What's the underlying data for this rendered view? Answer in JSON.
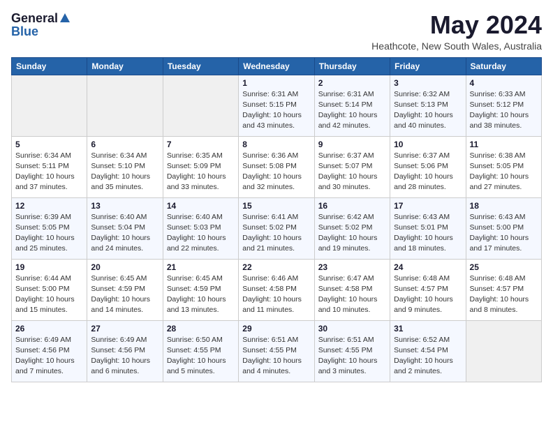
{
  "header": {
    "logo_general": "General",
    "logo_blue": "Blue",
    "title": "May 2024",
    "location": "Heathcote, New South Wales, Australia"
  },
  "days_of_week": [
    "Sunday",
    "Monday",
    "Tuesday",
    "Wednesday",
    "Thursday",
    "Friday",
    "Saturday"
  ],
  "weeks": [
    [
      {
        "num": "",
        "detail": ""
      },
      {
        "num": "",
        "detail": ""
      },
      {
        "num": "",
        "detail": ""
      },
      {
        "num": "1",
        "detail": "Sunrise: 6:31 AM\nSunset: 5:15 PM\nDaylight: 10 hours\nand 43 minutes."
      },
      {
        "num": "2",
        "detail": "Sunrise: 6:31 AM\nSunset: 5:14 PM\nDaylight: 10 hours\nand 42 minutes."
      },
      {
        "num": "3",
        "detail": "Sunrise: 6:32 AM\nSunset: 5:13 PM\nDaylight: 10 hours\nand 40 minutes."
      },
      {
        "num": "4",
        "detail": "Sunrise: 6:33 AM\nSunset: 5:12 PM\nDaylight: 10 hours\nand 38 minutes."
      }
    ],
    [
      {
        "num": "5",
        "detail": "Sunrise: 6:34 AM\nSunset: 5:11 PM\nDaylight: 10 hours\nand 37 minutes."
      },
      {
        "num": "6",
        "detail": "Sunrise: 6:34 AM\nSunset: 5:10 PM\nDaylight: 10 hours\nand 35 minutes."
      },
      {
        "num": "7",
        "detail": "Sunrise: 6:35 AM\nSunset: 5:09 PM\nDaylight: 10 hours\nand 33 minutes."
      },
      {
        "num": "8",
        "detail": "Sunrise: 6:36 AM\nSunset: 5:08 PM\nDaylight: 10 hours\nand 32 minutes."
      },
      {
        "num": "9",
        "detail": "Sunrise: 6:37 AM\nSunset: 5:07 PM\nDaylight: 10 hours\nand 30 minutes."
      },
      {
        "num": "10",
        "detail": "Sunrise: 6:37 AM\nSunset: 5:06 PM\nDaylight: 10 hours\nand 28 minutes."
      },
      {
        "num": "11",
        "detail": "Sunrise: 6:38 AM\nSunset: 5:05 PM\nDaylight: 10 hours\nand 27 minutes."
      }
    ],
    [
      {
        "num": "12",
        "detail": "Sunrise: 6:39 AM\nSunset: 5:05 PM\nDaylight: 10 hours\nand 25 minutes."
      },
      {
        "num": "13",
        "detail": "Sunrise: 6:40 AM\nSunset: 5:04 PM\nDaylight: 10 hours\nand 24 minutes."
      },
      {
        "num": "14",
        "detail": "Sunrise: 6:40 AM\nSunset: 5:03 PM\nDaylight: 10 hours\nand 22 minutes."
      },
      {
        "num": "15",
        "detail": "Sunrise: 6:41 AM\nSunset: 5:02 PM\nDaylight: 10 hours\nand 21 minutes."
      },
      {
        "num": "16",
        "detail": "Sunrise: 6:42 AM\nSunset: 5:02 PM\nDaylight: 10 hours\nand 19 minutes."
      },
      {
        "num": "17",
        "detail": "Sunrise: 6:43 AM\nSunset: 5:01 PM\nDaylight: 10 hours\nand 18 minutes."
      },
      {
        "num": "18",
        "detail": "Sunrise: 6:43 AM\nSunset: 5:00 PM\nDaylight: 10 hours\nand 17 minutes."
      }
    ],
    [
      {
        "num": "19",
        "detail": "Sunrise: 6:44 AM\nSunset: 5:00 PM\nDaylight: 10 hours\nand 15 minutes."
      },
      {
        "num": "20",
        "detail": "Sunrise: 6:45 AM\nSunset: 4:59 PM\nDaylight: 10 hours\nand 14 minutes."
      },
      {
        "num": "21",
        "detail": "Sunrise: 6:45 AM\nSunset: 4:59 PM\nDaylight: 10 hours\nand 13 minutes."
      },
      {
        "num": "22",
        "detail": "Sunrise: 6:46 AM\nSunset: 4:58 PM\nDaylight: 10 hours\nand 11 minutes."
      },
      {
        "num": "23",
        "detail": "Sunrise: 6:47 AM\nSunset: 4:58 PM\nDaylight: 10 hours\nand 10 minutes."
      },
      {
        "num": "24",
        "detail": "Sunrise: 6:48 AM\nSunset: 4:57 PM\nDaylight: 10 hours\nand 9 minutes."
      },
      {
        "num": "25",
        "detail": "Sunrise: 6:48 AM\nSunset: 4:57 PM\nDaylight: 10 hours\nand 8 minutes."
      }
    ],
    [
      {
        "num": "26",
        "detail": "Sunrise: 6:49 AM\nSunset: 4:56 PM\nDaylight: 10 hours\nand 7 minutes."
      },
      {
        "num": "27",
        "detail": "Sunrise: 6:49 AM\nSunset: 4:56 PM\nDaylight: 10 hours\nand 6 minutes."
      },
      {
        "num": "28",
        "detail": "Sunrise: 6:50 AM\nSunset: 4:55 PM\nDaylight: 10 hours\nand 5 minutes."
      },
      {
        "num": "29",
        "detail": "Sunrise: 6:51 AM\nSunset: 4:55 PM\nDaylight: 10 hours\nand 4 minutes."
      },
      {
        "num": "30",
        "detail": "Sunrise: 6:51 AM\nSunset: 4:55 PM\nDaylight: 10 hours\nand 3 minutes."
      },
      {
        "num": "31",
        "detail": "Sunrise: 6:52 AM\nSunset: 4:54 PM\nDaylight: 10 hours\nand 2 minutes."
      },
      {
        "num": "",
        "detail": ""
      }
    ]
  ]
}
